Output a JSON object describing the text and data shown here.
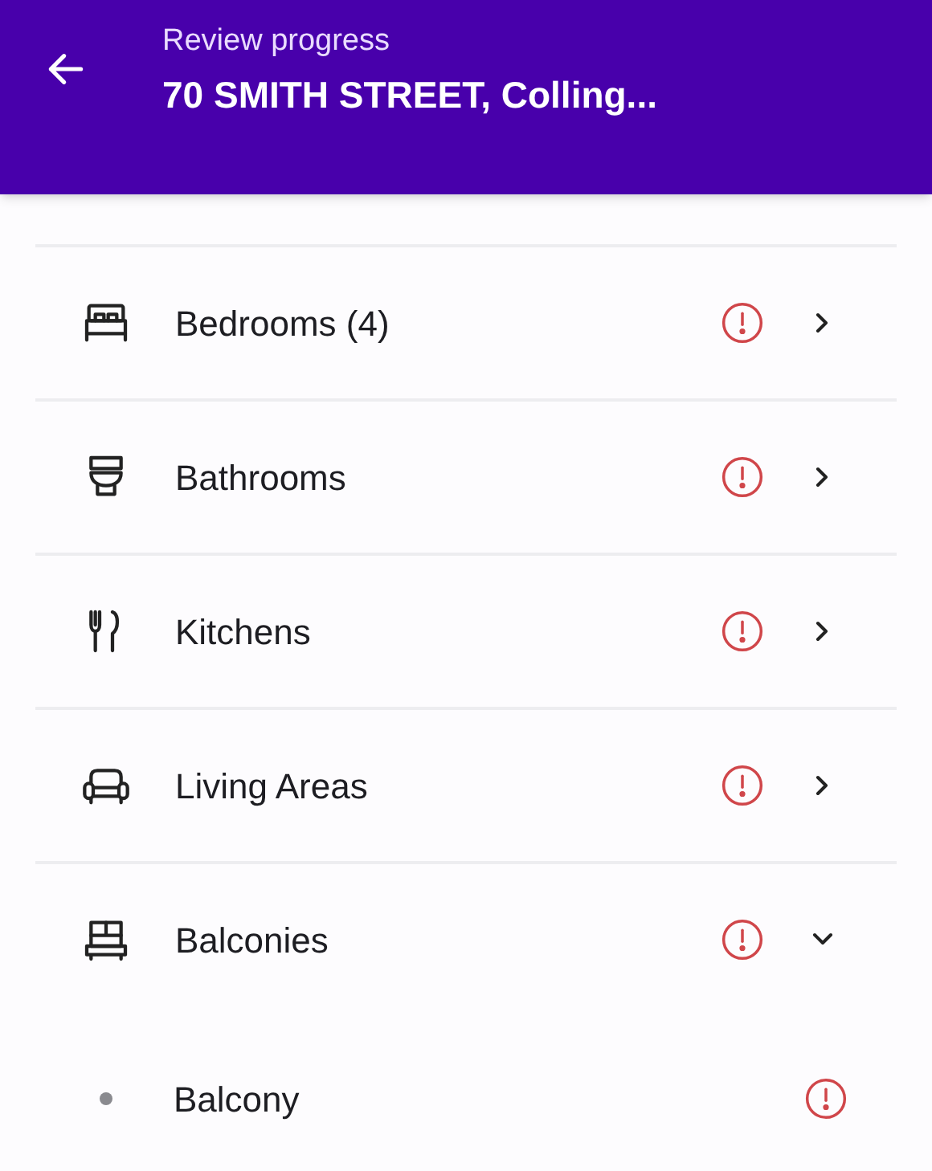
{
  "header": {
    "subtitle": "Review progress",
    "title": "70 SMITH STREET, Colling..."
  },
  "sections": [
    {
      "kind": "bed",
      "label": "Bedrooms (4)",
      "warning": true,
      "expanded": false
    },
    {
      "kind": "toilet",
      "label": "Bathrooms",
      "warning": true,
      "expanded": false
    },
    {
      "kind": "cutlery",
      "label": "Kitchens",
      "warning": true,
      "expanded": false
    },
    {
      "kind": "sofa",
      "label": "Living Areas",
      "warning": true,
      "expanded": false
    },
    {
      "kind": "balcony",
      "label": "Balconies",
      "warning": true,
      "expanded": true,
      "children": [
        {
          "label": "Balcony",
          "warning": true
        }
      ]
    }
  ]
}
